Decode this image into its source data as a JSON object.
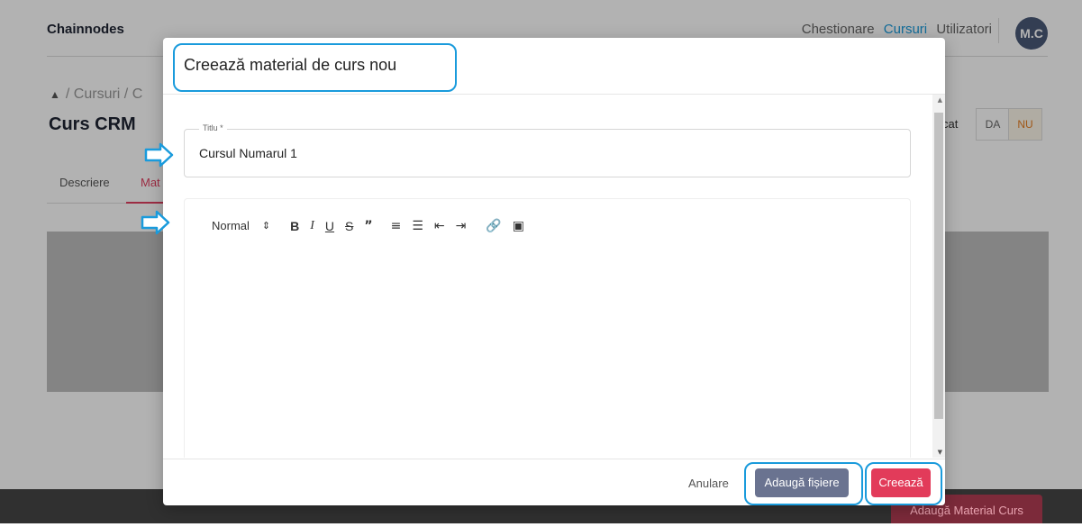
{
  "header": {
    "brand": "Chainnodes",
    "nav": [
      "Chestionare",
      "Cursuri",
      "Utilizatori"
    ],
    "avatar": "M.C"
  },
  "breadcrumb": {
    "part1": "/ Cursuri",
    "part2": "/ C"
  },
  "course": {
    "title": "Curs CRM"
  },
  "tabs": {
    "tab1": "Descriere",
    "tab2": "Mat"
  },
  "publish": {
    "label": "cat",
    "yes": "DA",
    "no": "NU"
  },
  "page_button": "Adaugă Material Curs",
  "modal": {
    "title": "Creează material de curs nou",
    "title_field": {
      "label": "Titlu *",
      "value": "Cursul Numarul 1"
    },
    "editor_toolbar": {
      "format": "Normal",
      "buttons": [
        "bold",
        "italic",
        "underline",
        "strike",
        "blockquote",
        "ordered-list",
        "bullet-list",
        "indent-decrease",
        "indent-increase",
        "link",
        "image"
      ]
    },
    "footer": {
      "cancel": "Anulare",
      "add_files": "Adaugă fișiere",
      "create": "Creează"
    }
  },
  "colors": {
    "accent": "#1a9bdc",
    "primary": "#e23b5a",
    "secondary": "#6a7390"
  }
}
